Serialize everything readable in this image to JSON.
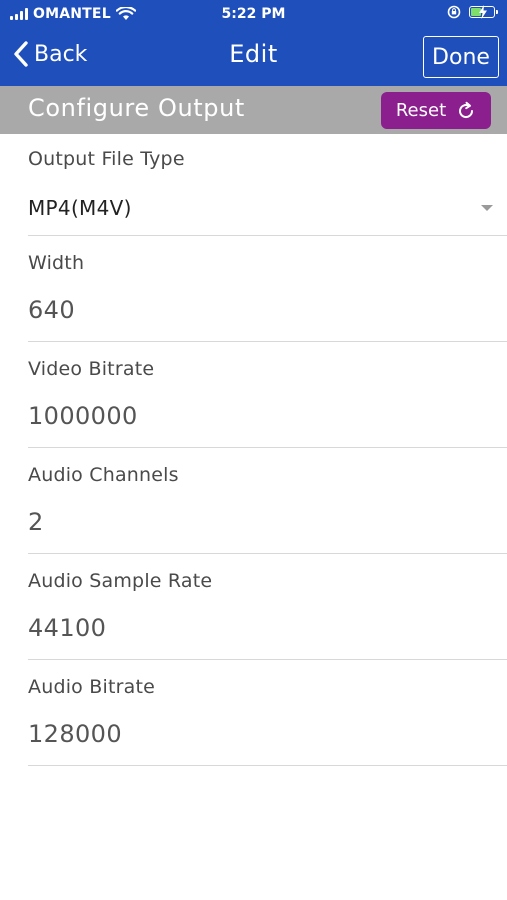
{
  "status_bar": {
    "carrier": "OMANTEL",
    "time": "5:22 PM"
  },
  "nav": {
    "back_label": "Back",
    "title": "Edit",
    "done_label": "Done"
  },
  "section": {
    "title": "Configure Output",
    "reset_label": "Reset"
  },
  "fields": [
    {
      "label": "Output File Type",
      "value": "MP4(M4V)"
    },
    {
      "label": "Width",
      "value": "640"
    },
    {
      "label": "Video Bitrate",
      "value": "1000000"
    },
    {
      "label": "Audio Channels",
      "value": "2"
    },
    {
      "label": "Audio Sample Rate",
      "value": "44100"
    },
    {
      "label": "Audio Bitrate",
      "value": "128000"
    }
  ],
  "colors": {
    "nav_background": "#1f4fba",
    "section_background": "#a9a9a9",
    "reset_button": "#8b1f8e"
  },
  "icons": [
    "signal-icon",
    "wifi-icon",
    "rotation-lock-icon",
    "battery-icon",
    "chevron-left-icon",
    "refresh-icon",
    "dropdown-caret-icon"
  ]
}
